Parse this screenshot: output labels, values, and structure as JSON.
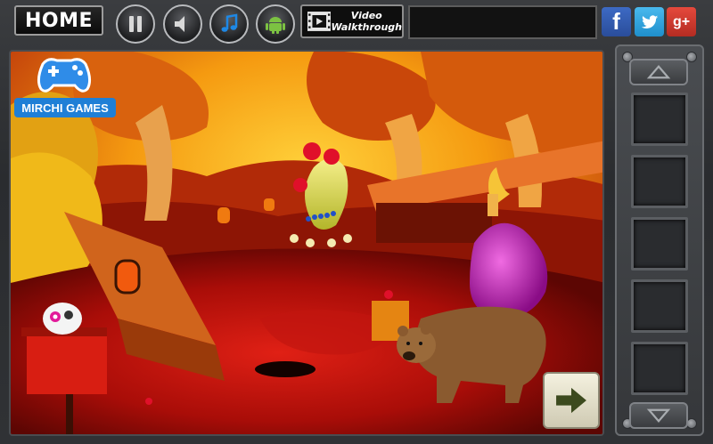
{
  "topbar": {
    "home_label": "HOME",
    "video_label_line1": "Video",
    "video_label_line2": "Walkthrough",
    "buttons": [
      "pause-icon",
      "sound-icon",
      "music-icon",
      "android-icon"
    ],
    "social": {
      "facebook": "f",
      "twitter": "t",
      "googleplus": "g+"
    }
  },
  "scene": {
    "logo_text": "MIRCHI GAMES",
    "colors": {
      "sky": "#f5a10e",
      "ground": "#a90d08",
      "purple_pot": "#c11db0",
      "bear": "#8a5a2f"
    }
  },
  "inventory": {
    "up_icon": "chevron-up-icon",
    "down_icon": "chevron-down-icon",
    "slot_count": 5
  },
  "next_icon": "arrow-right-icon"
}
